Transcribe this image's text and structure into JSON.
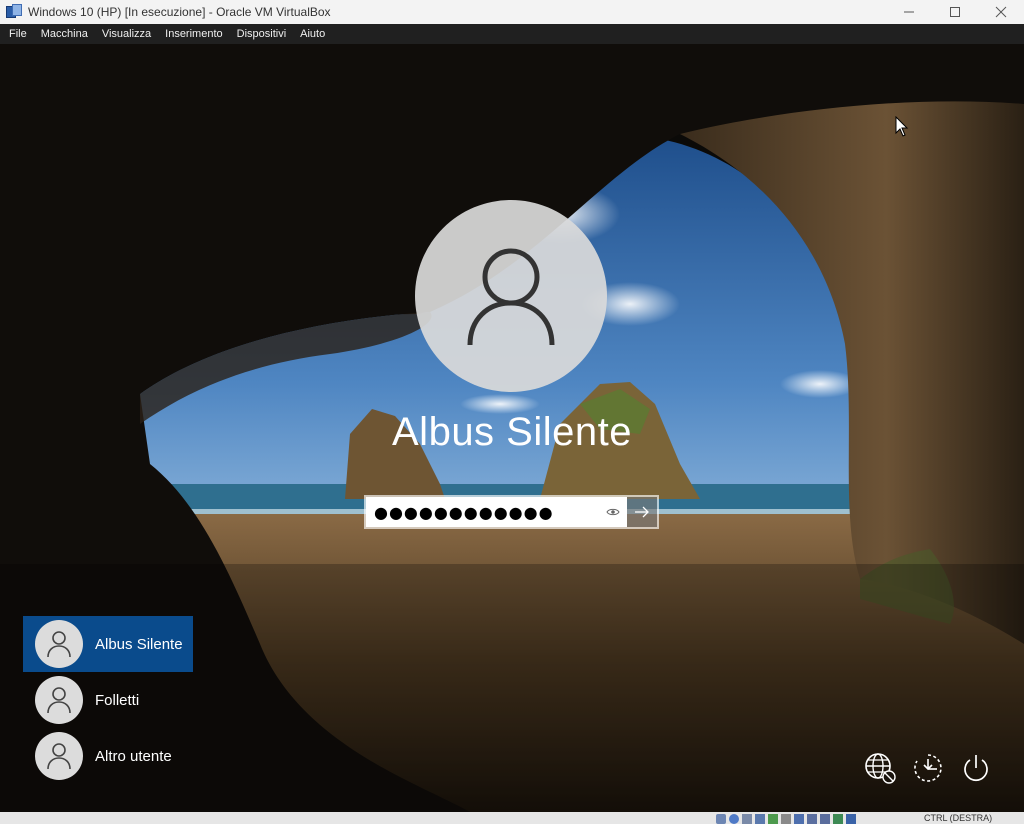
{
  "window": {
    "title": "Windows 10 (HP) [In esecuzione] - Oracle VM VirtualBox",
    "minimize": "—",
    "maximize": "☐",
    "close": "✕"
  },
  "menu": {
    "items": [
      {
        "label": "File"
      },
      {
        "label": "Macchina"
      },
      {
        "label": "Visualizza"
      },
      {
        "label": "Inserimento"
      },
      {
        "label": "Dispositivi"
      },
      {
        "label": "Aiuto"
      }
    ]
  },
  "login": {
    "user_name": "Albus Silente",
    "password_value": "●●●●●●●●●●●●",
    "reveal_icon": "eye-icon",
    "submit_icon": "arrow-right-icon"
  },
  "users": [
    {
      "name": "Albus Silente",
      "selected": true
    },
    {
      "name": "Folletti",
      "selected": false
    },
    {
      "name": "Altro utente",
      "selected": false
    }
  ],
  "corner_buttons": [
    "network-icon",
    "accessibility-icon",
    "power-icon"
  ],
  "statusbar": {
    "host_key": "CTRL (DESTRA)"
  },
  "colors": {
    "selected_user": "#0a4b8c",
    "titlebar": "#f3f3f3",
    "menubar": "#202020"
  }
}
